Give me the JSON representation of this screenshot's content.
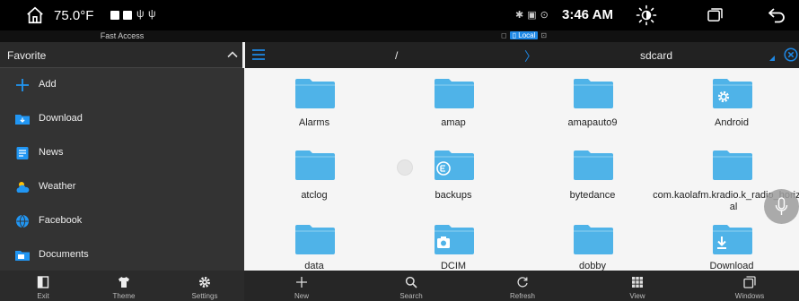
{
  "status_bar": {
    "temperature": "75.0°F",
    "time": "3:46 AM",
    "usb_glyph": "ψ"
  },
  "left_panel": {
    "fast_access_label": "Fast Access",
    "favorite_label": "Favorite",
    "items": [
      {
        "label": "Add",
        "icon": "plus-icon",
        "color": "#2196f3"
      },
      {
        "label": "Download",
        "icon": "download-folder-icon",
        "color": "#2196f3"
      },
      {
        "label": "News",
        "icon": "news-icon",
        "color": "#2196f3"
      },
      {
        "label": "Weather",
        "icon": "weather-icon",
        "color": "#2196f3"
      },
      {
        "label": "Facebook",
        "icon": "globe-icon",
        "color": "#2196f3"
      },
      {
        "label": "Documents",
        "icon": "documents-icon",
        "color": "#2196f3"
      }
    ]
  },
  "top_bar": {
    "local_label": "Local"
  },
  "path_bar": {
    "root": "/",
    "current": "sdcard"
  },
  "files": [
    {
      "name": "Alarms",
      "badge": ""
    },
    {
      "name": "amap",
      "badge": ""
    },
    {
      "name": "amapauto9",
      "badge": ""
    },
    {
      "name": "Android",
      "badge": "gear"
    },
    {
      "name": "atclog",
      "badge": ""
    },
    {
      "name": "backups",
      "badge": "e"
    },
    {
      "name": "bytedance",
      "badge": ""
    },
    {
      "name": "com.kaolafm.kradio.k_radio_horizontal",
      "badge": ""
    },
    {
      "name": "data",
      "badge": ""
    },
    {
      "name": "DCIM",
      "badge": "camera"
    },
    {
      "name": "dobby",
      "badge": ""
    },
    {
      "name": "Download",
      "badge": "download"
    }
  ],
  "bottom_left": [
    {
      "label": "Exit",
      "icon": "exit-icon"
    },
    {
      "label": "Theme",
      "icon": "shirt-icon"
    },
    {
      "label": "Settings",
      "icon": "gear-icon"
    }
  ],
  "bottom_right": [
    {
      "label": "New",
      "icon": "plus-icon"
    },
    {
      "label": "Search",
      "icon": "search-icon"
    },
    {
      "label": "Refresh",
      "icon": "refresh-icon"
    },
    {
      "label": "View",
      "icon": "grid-icon"
    },
    {
      "label": "Windows",
      "icon": "windows-icon"
    }
  ],
  "colors": {
    "accent": "#1e88e5",
    "folder": "#4fb3e8"
  }
}
